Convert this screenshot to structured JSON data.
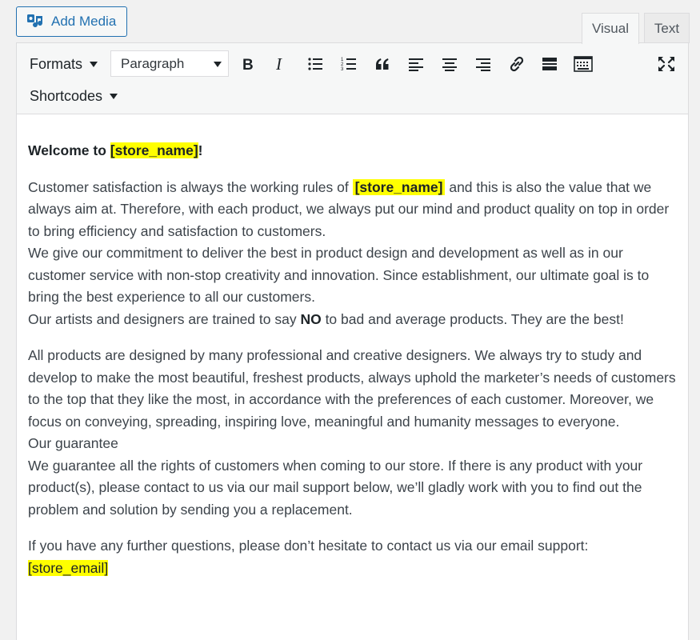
{
  "header": {
    "add_media_label": "Add Media",
    "tabs": [
      {
        "label": "Visual",
        "active": true
      },
      {
        "label": "Text",
        "active": false
      }
    ]
  },
  "toolbar": {
    "formats_label": "Formats",
    "paragraph_value": "Paragraph",
    "shortcodes_label": "Shortcodes",
    "buttons": [
      "bold-icon",
      "italic-icon",
      "bulleted-list-icon",
      "numbered-list-icon",
      "blockquote-icon",
      "align-left-icon",
      "align-center-icon",
      "align-right-icon",
      "insert-link-icon",
      "read-more-icon",
      "toolbar-toggle-icon",
      "fullscreen-icon"
    ]
  },
  "content": {
    "welcome_prefix": "Welcome to ",
    "welcome_tag": "[store_name]",
    "welcome_suffix": "!",
    "p1_a": "Customer satisfaction is always the working rules of ",
    "p1_tag": "[store_name]",
    "p1_b": " and this is also the value that we always aim at. Therefore, with each product, we always put our mind and product quality on top in order to bring efficiency and satisfaction to customers.",
    "p1_c": "We give our commitment to deliver the best in product design and development as well as in our customer service with non-stop creativity and innovation. Since establishment, our ultimate goal is to bring the best experience to all our customers.",
    "p1_d1": "Our artists and designers are trained to say ",
    "p1_d_bold": "NO",
    "p1_d2": " to bad and average products. They are the best!",
    "p2_a": "All products are designed by many professional and creative designers. We always try to study and develop to make the most beautiful, freshest products, always uphold the marketer’s needs of customers to the top that they like the most, in accordance with the preferences of each customer. Moreover, we focus on conveying, spreading, inspiring love, meaningful and humanity messages to everyone.",
    "p2_b": "Our guarantee",
    "p2_c": "We guarantee all the rights of customers when coming to our store. If there is any product with your product(s), please contact to us via our mail support below, we’ll gladly work with you to find out the problem and solution by sending you a replacement.",
    "p3_a": "If you have any further questions, please don’t hesitate to contact us via our email support:",
    "p3_tag": "[store_email]"
  },
  "colors": {
    "accent": "#2271b1",
    "highlight": "#ffff00"
  }
}
